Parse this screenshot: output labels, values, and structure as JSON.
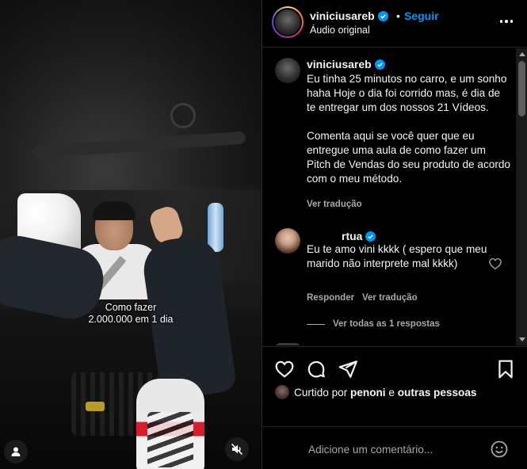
{
  "video": {
    "overlay_line1": "Como fazer",
    "overlay_line2": "2.000.000 em 1 dia"
  },
  "header": {
    "username": "viniciusareb",
    "separator": "•",
    "follow_label": "Seguir",
    "audio_label": "Áudio original"
  },
  "caption": {
    "username": "viniciusareb",
    "text": "Eu tinha 25 minutos no carro, e um sonho haha Hoje o dia foi corrido mas, é dia de te entregar um dos nossos 21 Vídeos.\n\nComenta aqui se você quer que eu entregue uma aula de como fazer um Pitch de Vendas do seu produto de acordo com o meu método.",
    "translate_label": "Ver tradução"
  },
  "comment": {
    "username": "rtua",
    "text": "Eu te amo vini kkkk ( espero que meu marido não interprete mal kkkk)",
    "reply_label": "Responder",
    "translate_label": "Ver tradução",
    "view_replies_label": "Ver todas as 1 respostas"
  },
  "likes": {
    "prefix": "Curtido por",
    "user": "penoni",
    "conjunction": "e",
    "others": "outras pessoas"
  },
  "composer": {
    "placeholder": "Adicione um comentário..."
  },
  "colors": {
    "accent": "#0095f6",
    "background": "#000000",
    "text": "#f5f5f5",
    "muted": "#a8a8a8"
  },
  "icons": [
    "heart-icon",
    "comment-icon",
    "share-icon",
    "bookmark-icon",
    "emoji-icon",
    "mute-icon",
    "user-tag-icon",
    "more-icon",
    "verified-badge-icon"
  ]
}
